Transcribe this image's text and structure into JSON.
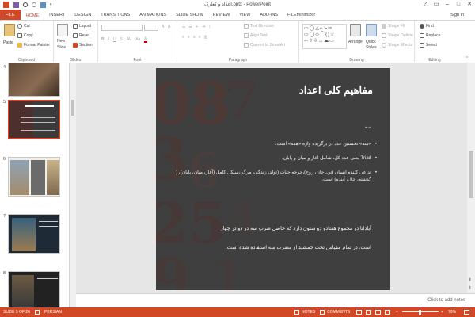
{
  "window": {
    "title": "اعداد و کعارک.pptx - PowerPoint",
    "controls": [
      "?",
      "▭",
      "–",
      "□",
      "✕"
    ]
  },
  "tabs": [
    {
      "label": "FILE"
    },
    {
      "label": "HOME"
    },
    {
      "label": "INSERT"
    },
    {
      "label": "DESIGN"
    },
    {
      "label": "TRANSITIONS"
    },
    {
      "label": "ANIMATIONS"
    },
    {
      "label": "SLIDE SHOW"
    },
    {
      "label": "REVIEW"
    },
    {
      "label": "VIEW"
    },
    {
      "label": "ADD-INS"
    },
    {
      "label": "FILEminimizer"
    }
  ],
  "signin": "Sign in",
  "ribbon": {
    "clipboard": {
      "paste": "Paste",
      "cut": "Cut",
      "copy": "Copy",
      "format_painter": "Format Painter",
      "label": "Clipboard"
    },
    "slides": {
      "new_slide": "New",
      "new_slide2": "Slide",
      "layout": "Layout",
      "reset": "Reset",
      "section": "Section",
      "label": "Slides"
    },
    "font": {
      "label": "Font"
    },
    "paragraph": {
      "text_direction": "Text Direction",
      "align_text": "Align Text",
      "convert_smartart": "Convert to SmartArt",
      "label": "Paragraph"
    },
    "drawing": {
      "arrange": "Arrange",
      "quick_styles": "Quick",
      "quick_styles2": "Styles",
      "shape_fill": "Shape Fill",
      "shape_outline": "Shape Outline",
      "shape_effects": "Shape Effects",
      "label": "Drawing"
    },
    "editing": {
      "find": "Find",
      "replace": "Replace",
      "select": "Select",
      "label": "Editing"
    }
  },
  "thumbnails": [
    {
      "number": "4"
    },
    {
      "number": "5"
    },
    {
      "number": "6"
    },
    {
      "number": "7"
    },
    {
      "number": "8"
    }
  ],
  "slide": {
    "title": "مفاهیم کلی اعداد",
    "subtitle": "سه",
    "bullets": [
      "«سه» نخستین عدد در برگزیده واژه «همه» است.",
      "Triad یعنی عدد کل، شامل آغاز و میان و پایان.",
      "تداعی کننده انسان (تن، جان، روح)،چرخه حیات (تولد، زندگی، مرگ)،سیکل کامل (آغاز، میان، پایان)، ( گذشته، حال، آینده) است."
    ],
    "para1": "آپادانا در مجموع هفتادو دو ستون دارد که حاصل ضرب سه در دو در چهار",
    "para2": "است. در تمام مقیاس تخت جمشید از مضرب سه استفاده شده است."
  },
  "notes_placeholder": "Click to add notes",
  "status": {
    "slide": "SLIDE 5 OF 26",
    "language": "PERSIAN",
    "notes": "NOTES",
    "comments": "COMMENTS",
    "zoom": "70%"
  },
  "colors": {
    "accent": "#d24726"
  }
}
